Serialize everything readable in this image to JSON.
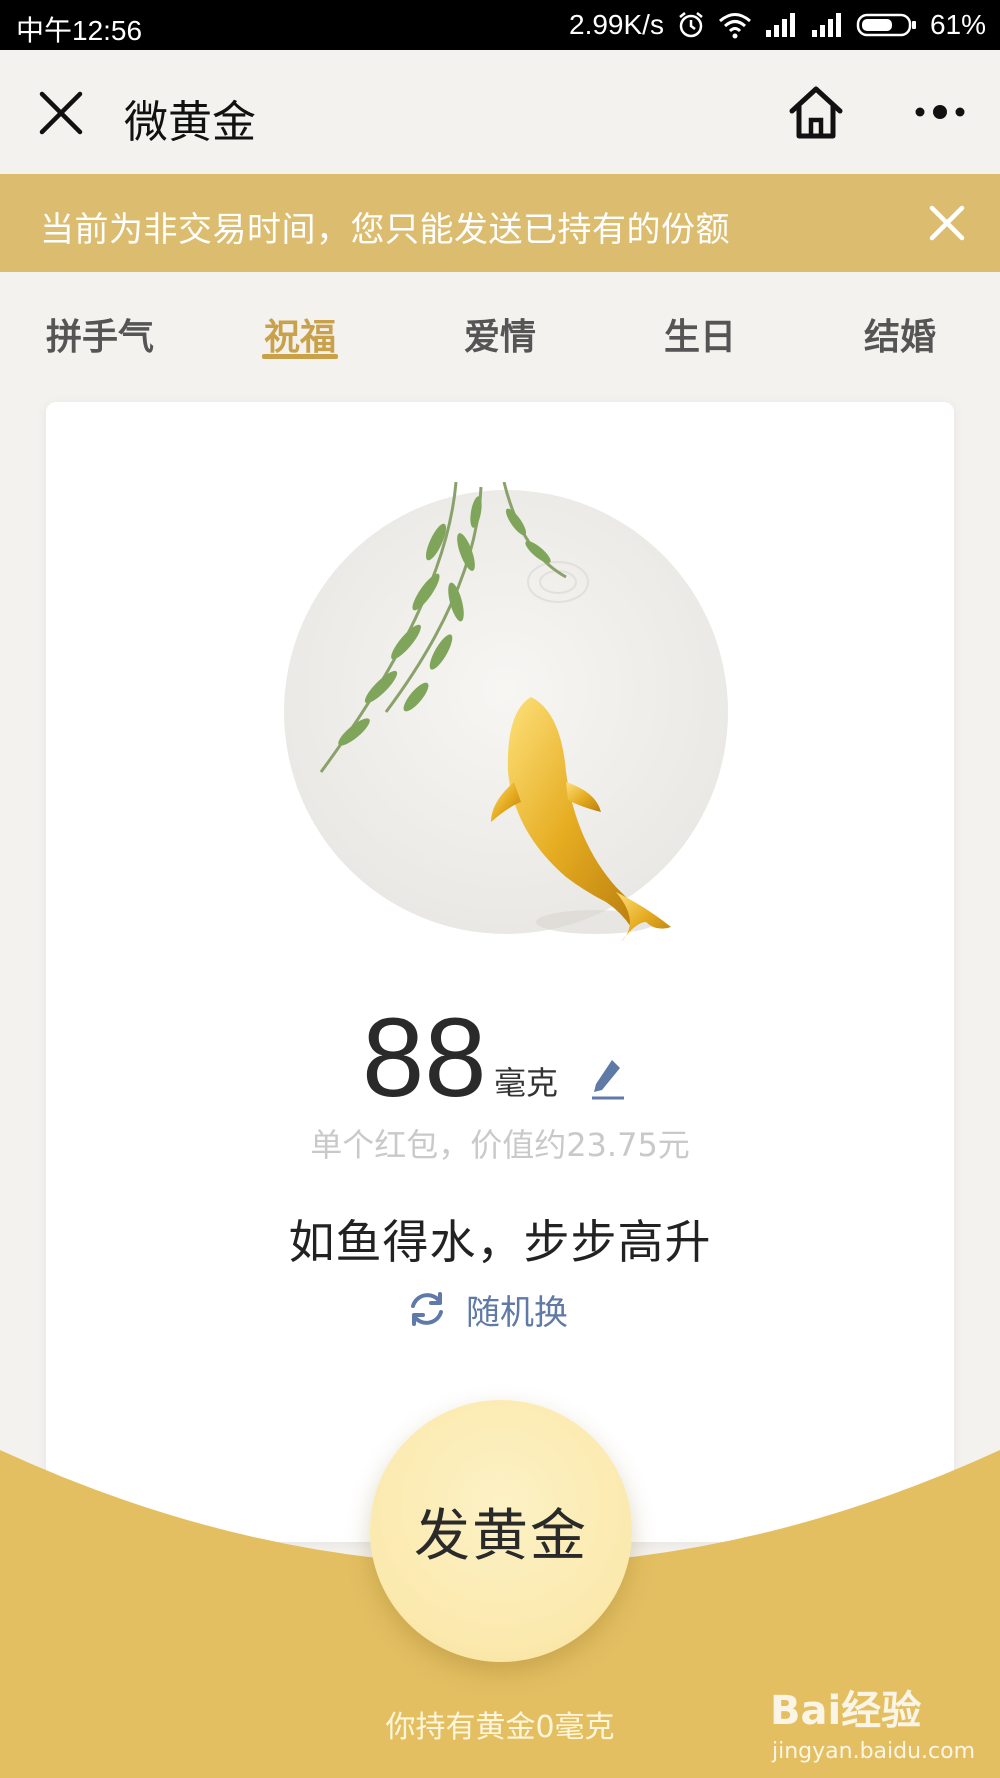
{
  "status_bar": {
    "time": "中午12:56",
    "speed": "2.99K/s",
    "battery": "61%"
  },
  "nav": {
    "title": "微黄金"
  },
  "banner": {
    "text": "当前为非交易时间，您只能发送已持有的份额"
  },
  "tabs": [
    {
      "label": "拼手气",
      "active": false
    },
    {
      "label": "祝福",
      "active": true
    },
    {
      "label": "爱情",
      "active": false
    },
    {
      "label": "生日",
      "active": false
    },
    {
      "label": "结婚",
      "active": false
    }
  ],
  "card": {
    "amount": "88",
    "unit": "毫克",
    "value_text": "单个红包，价值约23.75元",
    "blessing": "如鱼得水，步步高升",
    "random_label": "随机换"
  },
  "send_button": {
    "label": "发黄金"
  },
  "holding_text": "你持有黄金0毫克",
  "watermark": {
    "brand": "Bai经验",
    "url": "jingyan.baidu.com"
  },
  "colors": {
    "banner": "#dcbd70",
    "active_tab": "#c9a14a",
    "bottom_gold": "#e4bf62",
    "button": "#fbe9ad",
    "link_blue": "#5f7aa6"
  }
}
